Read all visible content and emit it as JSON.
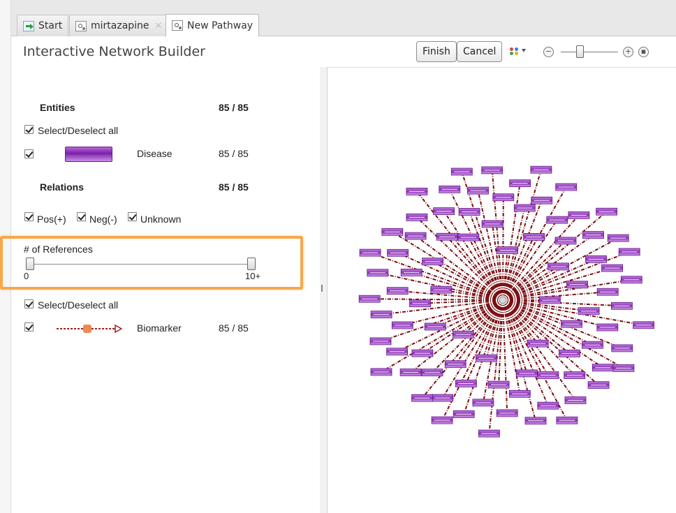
{
  "tabs": [
    {
      "label": "Start",
      "icon": "start-arrow-icon",
      "active": false,
      "closable": false
    },
    {
      "label": "mirtazapine",
      "icon": "pathway-icon",
      "active": false,
      "closable": true
    },
    {
      "label": "New Pathway",
      "icon": "pathway-icon",
      "active": true,
      "closable": false
    }
  ],
  "header": {
    "title": "Interactive Network Builder",
    "finish_label": "Finish",
    "cancel_label": "Cancel",
    "zoom_out_symbol": "−",
    "zoom_in_symbol": "+",
    "zoom_fit_symbol": "▪",
    "zoom_level_fraction": 0.35
  },
  "entities": {
    "heading": "Entities",
    "count": "85 /  85",
    "select_all_label": "Select/Deselect all",
    "items": [
      {
        "label": "Disease",
        "count": "85 /  85",
        "checked": true
      }
    ]
  },
  "relations": {
    "heading": "Relations",
    "count": "85 /  85",
    "filters": [
      {
        "label": "Pos(+)",
        "checked": true
      },
      {
        "label": "Neg(-)",
        "checked": true
      },
      {
        "label": "Unknown",
        "checked": true
      }
    ],
    "references": {
      "label": "# of References",
      "min_label": "0",
      "max_label": "10+",
      "range": [
        0,
        10
      ]
    },
    "select_all_label": "Select/Deselect all",
    "items": [
      {
        "label": "Biomarker",
        "count": "85 /  85",
        "checked": true
      }
    ]
  },
  "network": {
    "hub_node": "drug",
    "node_count": 85,
    "node_color": "#8a2fb5",
    "edge_color": "#7a0e12",
    "edge_style": "dashed"
  },
  "colors": {
    "highlight": "#f6a84a",
    "entity_purple": "#8a2fb5",
    "edge_red": "#7a0e12",
    "biomarker_orange": "#ee8a52"
  }
}
